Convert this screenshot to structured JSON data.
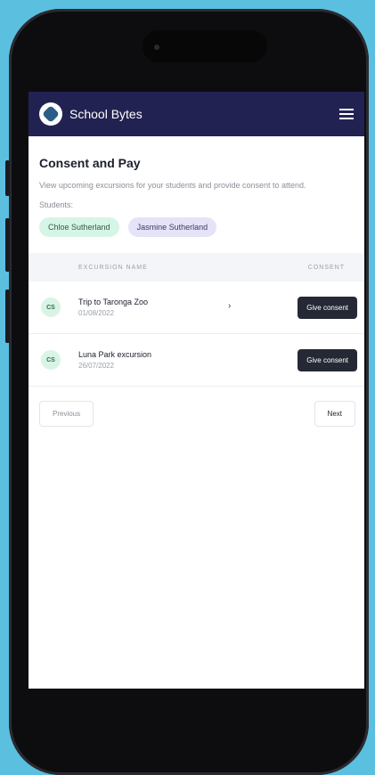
{
  "header": {
    "brand": "School Bytes",
    "icons": [
      "school-bytes-logo-icon",
      "hamburger-menu-icon"
    ]
  },
  "page": {
    "title": "Consent and Pay",
    "description": "View upcoming excursions for your students and provide consent to attend.",
    "students_label": "Students:"
  },
  "students": [
    {
      "name": "Chloe Sutherland"
    },
    {
      "name": "Jasmine Sutherland"
    }
  ],
  "table": {
    "columns": [
      "EXCURSION NAME",
      "CONSENT"
    ],
    "rows": [
      {
        "initials": "CS",
        "name": "Trip to Taronga Zoo",
        "date": "01/08/2022",
        "action": "Give consent"
      },
      {
        "initials": "CS",
        "name": "Luna Park excursion",
        "date": "26/07/2022",
        "action": "Give consent"
      }
    ]
  },
  "pagination": {
    "previous": "Previous",
    "next": "Next"
  },
  "colors": {
    "background": "#5bbfe0",
    "header": "#222252",
    "button": "#252935",
    "chip_green": "#d6f5e6",
    "chip_purple": "#e4e3f7"
  }
}
